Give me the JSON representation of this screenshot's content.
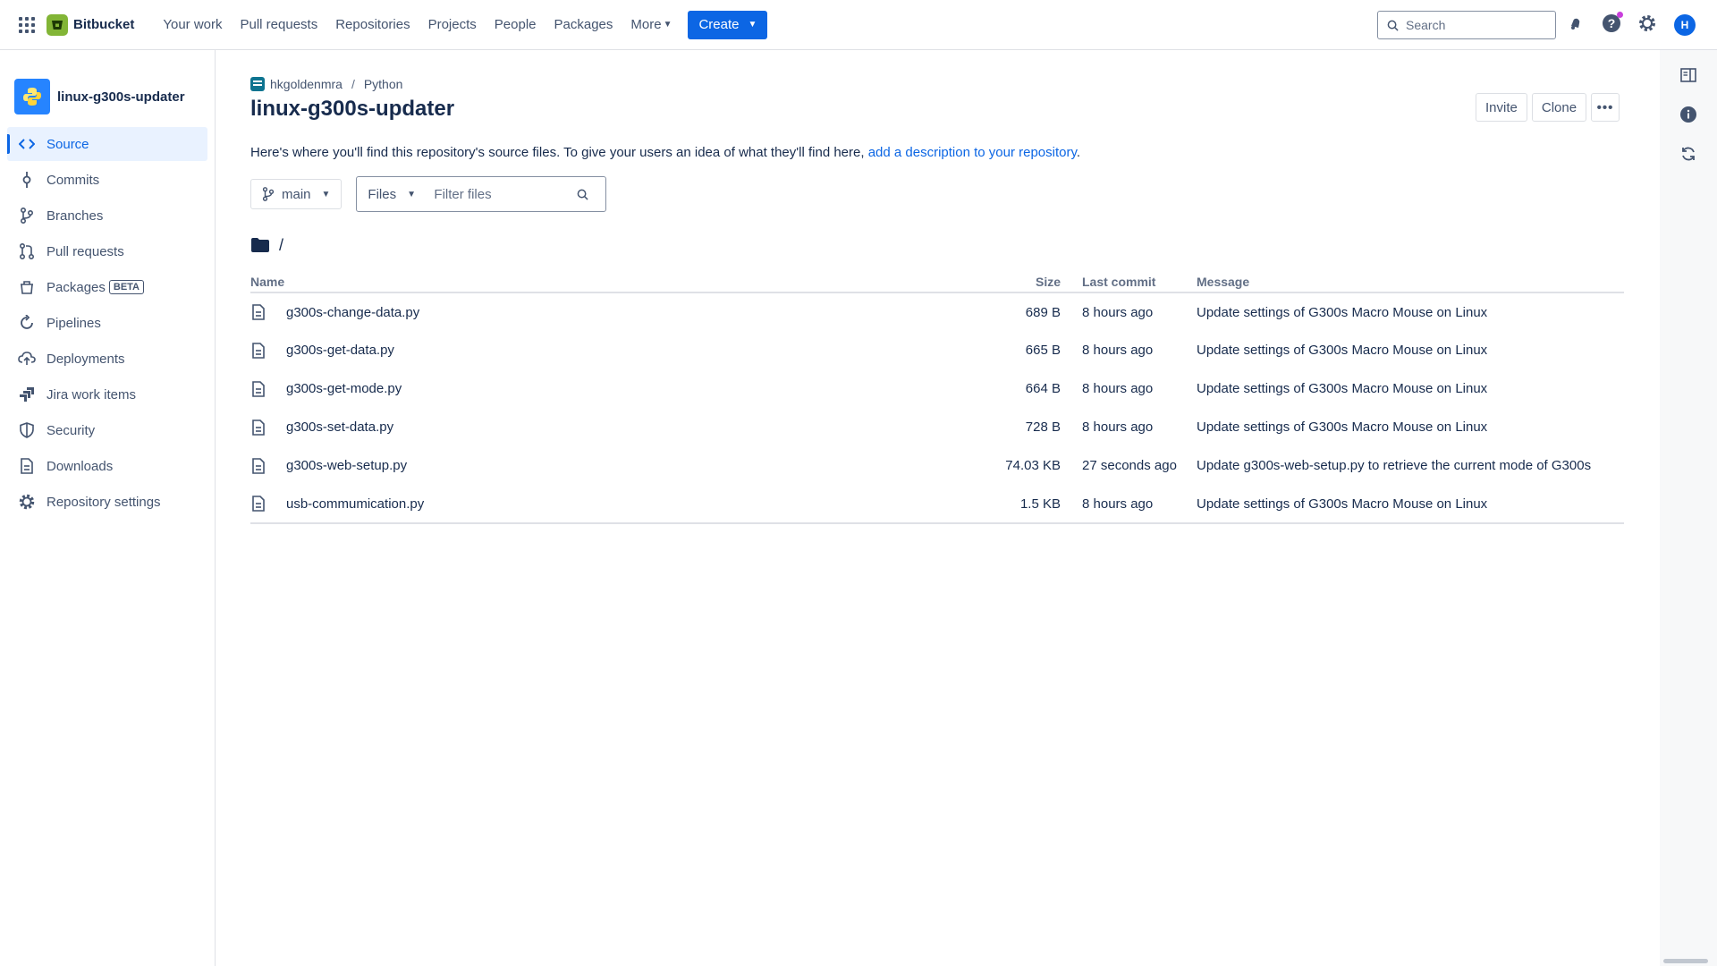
{
  "topbar": {
    "brand": "Bitbucket",
    "nav": [
      "Your work",
      "Pull requests",
      "Repositories",
      "Projects",
      "People",
      "Packages",
      "More"
    ],
    "create_label": "Create",
    "search_placeholder": "Search",
    "avatar_initial": "H"
  },
  "sidebar": {
    "repo_name": "linux-g300s-updater",
    "items": [
      {
        "label": "Source",
        "icon": "code-icon"
      },
      {
        "label": "Commits",
        "icon": "commit-icon"
      },
      {
        "label": "Branches",
        "icon": "branch-icon"
      },
      {
        "label": "Pull requests",
        "icon": "pull-request-icon"
      },
      {
        "label": "Packages",
        "icon": "package-icon",
        "badge": "BETA"
      },
      {
        "label": "Pipelines",
        "icon": "pipelines-icon"
      },
      {
        "label": "Deployments",
        "icon": "deployments-icon"
      },
      {
        "label": "Jira work items",
        "icon": "jira-icon"
      },
      {
        "label": "Security",
        "icon": "shield-icon"
      },
      {
        "label": "Downloads",
        "icon": "download-icon"
      },
      {
        "label": "Repository settings",
        "icon": "gear-icon"
      }
    ]
  },
  "main": {
    "breadcrumb": {
      "workspace": "hkgoldenmra",
      "project": "Python"
    },
    "title": "linux-g300s-updater",
    "actions": {
      "invite": "Invite",
      "clone": "Clone",
      "more": "•••"
    },
    "description_prefix": "Here's where you'll find this repository's source files. To give your users an idea of what they'll find here,",
    "description_link": "add a description to your repository",
    "description_suffix": ".",
    "branch": "main",
    "filter_type": "Files",
    "filter_placeholder": "Filter files",
    "path": "/",
    "columns": {
      "name": "Name",
      "size": "Size",
      "last_commit": "Last commit",
      "message": "Message"
    },
    "files": [
      {
        "name": "g300s-change-data.py",
        "size": "689 B",
        "last_commit": "8 hours ago",
        "message": "Update settings of G300s Macro Mouse on Linux"
      },
      {
        "name": "g300s-get-data.py",
        "size": "665 B",
        "last_commit": "8 hours ago",
        "message": "Update settings of G300s Macro Mouse on Linux"
      },
      {
        "name": "g300s-get-mode.py",
        "size": "664 B",
        "last_commit": "8 hours ago",
        "message": "Update settings of G300s Macro Mouse on Linux"
      },
      {
        "name": "g300s-set-data.py",
        "size": "728 B",
        "last_commit": "8 hours ago",
        "message": "Update settings of G300s Macro Mouse on Linux"
      },
      {
        "name": "g300s-web-setup.py",
        "size": "74.03 KB",
        "last_commit": "27 seconds ago",
        "message": "Update g300s-web-setup.py to retrieve the current mode of G300s"
      },
      {
        "name": "usb-commumication.py",
        "size": "1.5 KB",
        "last_commit": "8 hours ago",
        "message": "Update settings of G300s Macro Mouse on Linux"
      }
    ]
  },
  "colors": {
    "brand": "#0c66e4",
    "logo": "#82b536",
    "text": "#172b4d"
  }
}
